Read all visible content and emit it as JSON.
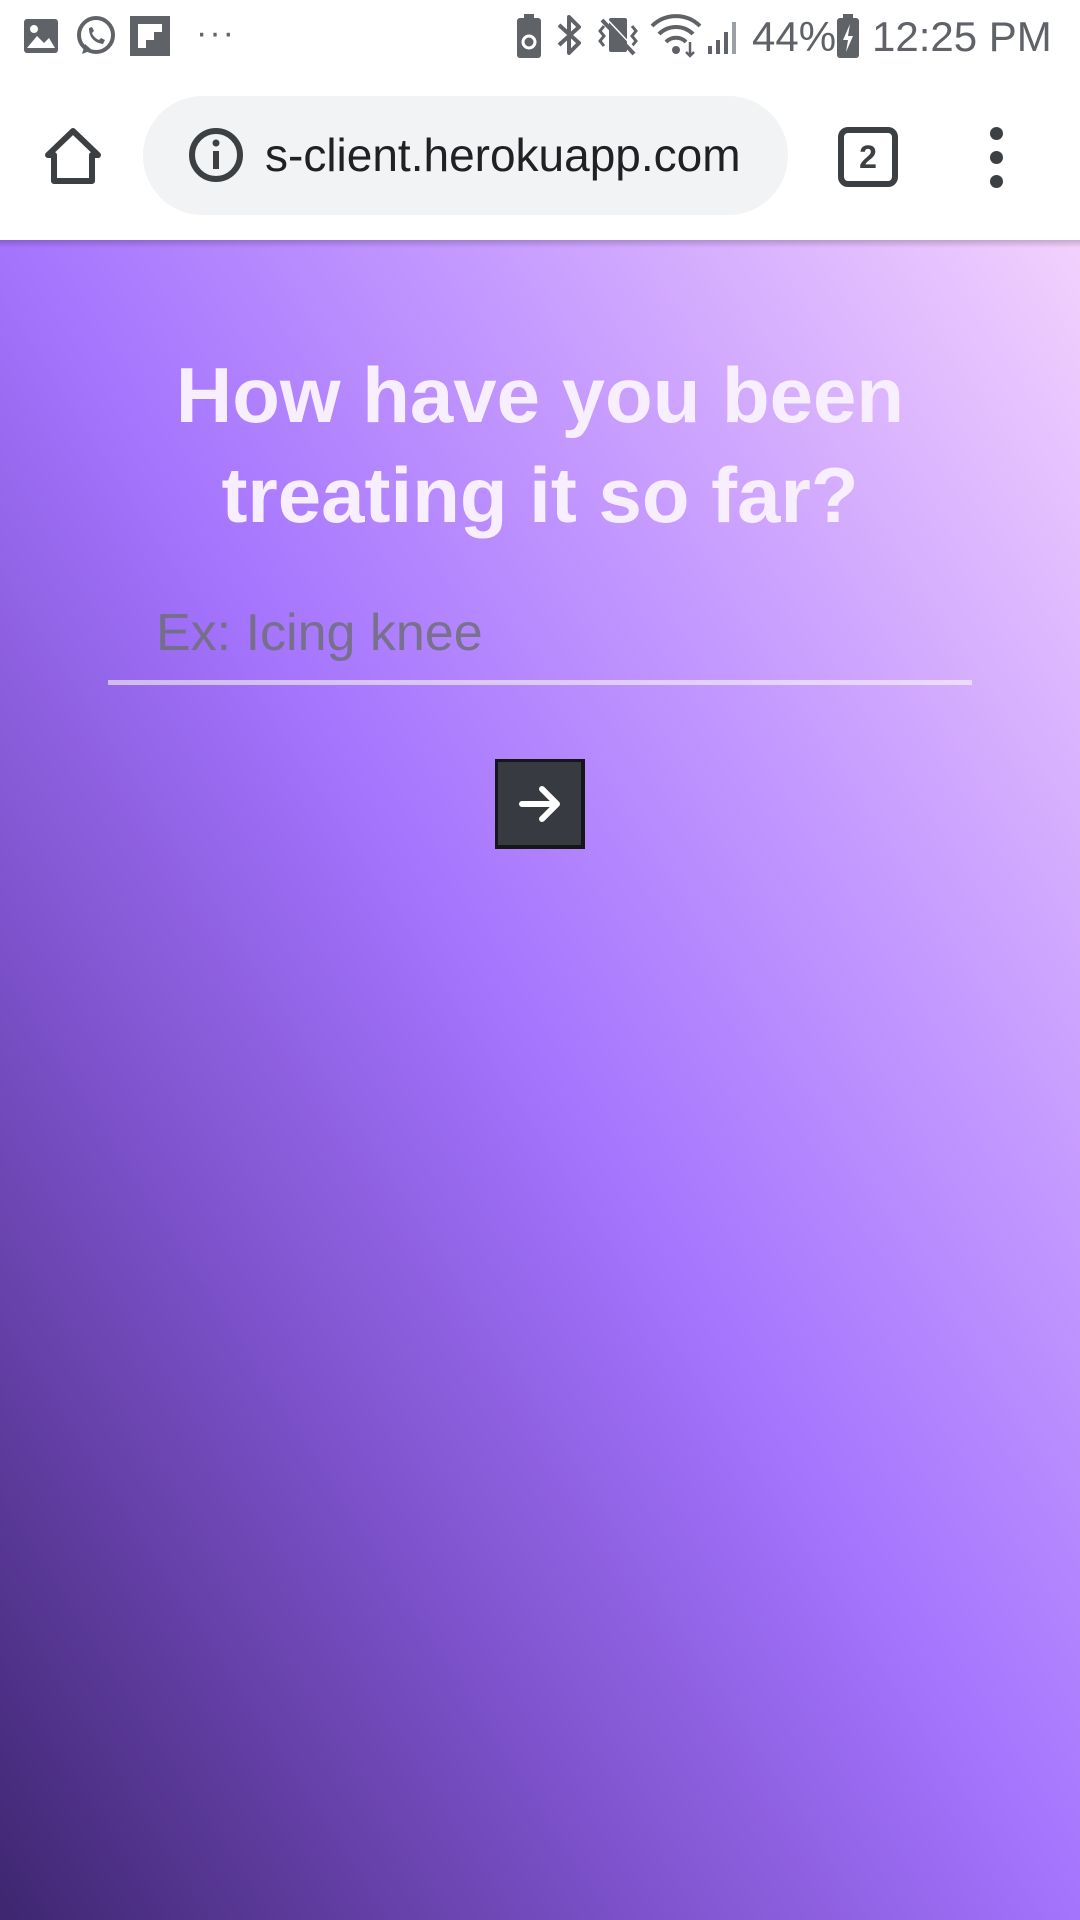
{
  "status_bar": {
    "notification_icons": [
      "gallery-icon",
      "whatsapp-icon",
      "flipboard-icon",
      "more-notifications-icon"
    ],
    "more_label": "···",
    "system_icons": [
      "battery-saver-icon",
      "bluetooth-icon",
      "vibrate-icon",
      "wifi-icon",
      "signal-icon",
      "battery-charging-icon"
    ],
    "battery": "44%",
    "time": "12:25 PM"
  },
  "browser": {
    "url": "s-client.herokuapp.com",
    "tab_count": "2",
    "icons": [
      "home-icon",
      "info-icon",
      "tab-switcher-icon",
      "overflow-menu-icon"
    ]
  },
  "page": {
    "question": "How have you been treating it so far?",
    "input_placeholder": "Ex: Icing knee",
    "input_value": "",
    "submit_icon": "arrow-right-icon",
    "colors": {
      "gradient_dark": "#3e2670",
      "gradient_mid": "#a474fd",
      "gradient_light": "#f2d1fd",
      "button_bg": "#383a42"
    }
  }
}
